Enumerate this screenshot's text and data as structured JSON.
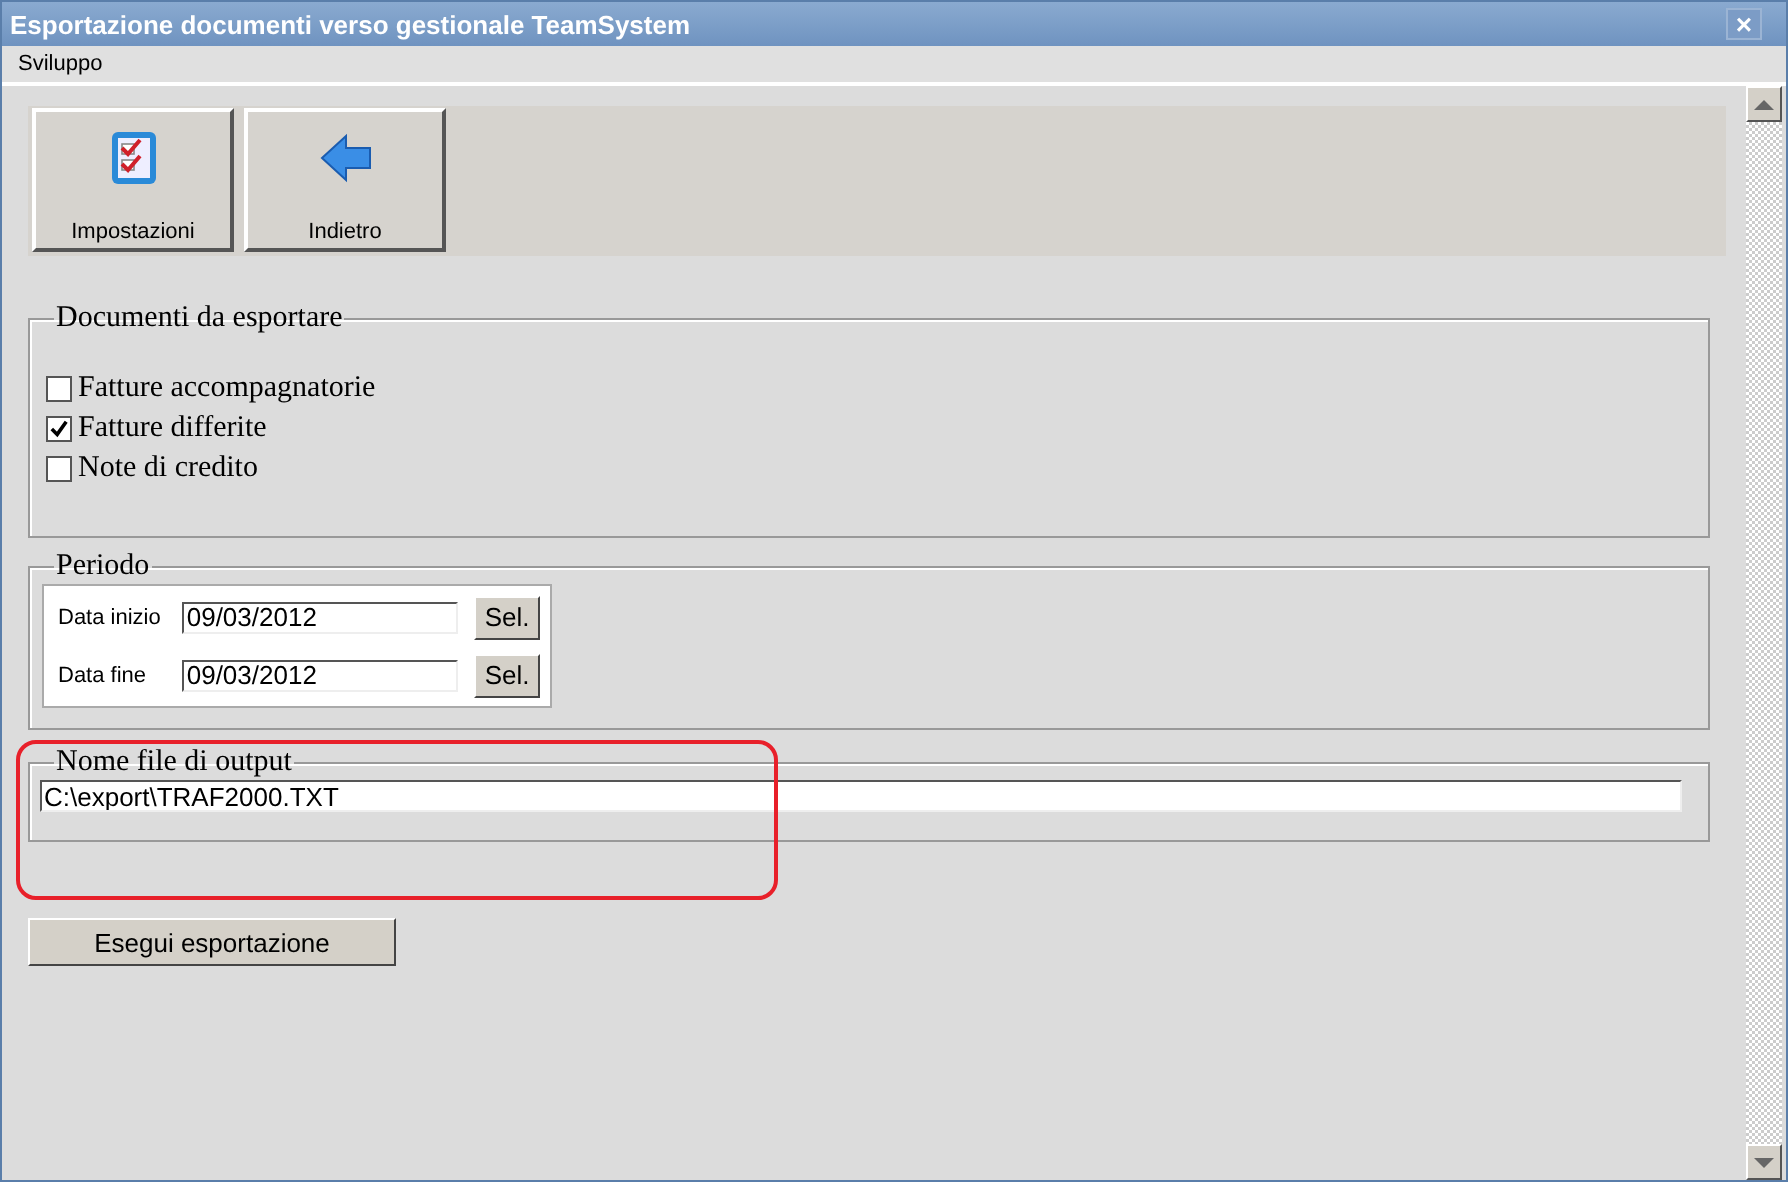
{
  "window": {
    "title": "Esportazione documenti verso gestionale TeamSystem",
    "close": "×"
  },
  "menu": [
    "Sviluppo"
  ],
  "toolbar": [
    {
      "label": "Impostazioni",
      "kind": "checklist"
    },
    {
      "label": "Indietro",
      "kind": "back"
    }
  ],
  "documents": {
    "legend": "Documenti da esportare",
    "options": [
      {
        "label": "Fatture accompagnatorie",
        "checked": false
      },
      {
        "label": "Fatture differite",
        "checked": true
      },
      {
        "label": "Note di credito",
        "checked": false
      }
    ]
  },
  "period": {
    "legend": "Periodo",
    "rows": [
      {
        "label": "Data inizio",
        "value": "09/03/2012",
        "button": "Sel."
      },
      {
        "label": "Data fine",
        "value": "09/03/2012",
        "button": "Sel."
      }
    ]
  },
  "output": {
    "legend": "Nome file di output",
    "value": "C:\\export\\TRAF2000.TXT"
  },
  "run_button": "Esegui esportazione"
}
